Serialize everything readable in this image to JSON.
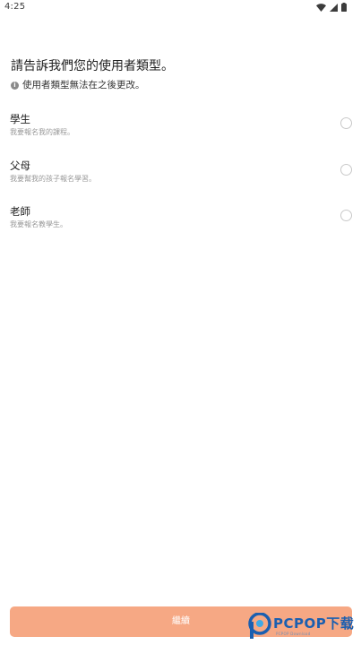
{
  "status_bar": {
    "time": "4:25",
    "icons": [
      "wifi-icon",
      "signal-icon",
      "battery-icon"
    ]
  },
  "header": {
    "title": "請告訴我們您的使用者類型。",
    "note": "使用者類型無法在之後更改。",
    "note_icon": "info-icon"
  },
  "options": [
    {
      "title": "學生",
      "description": "我要報名我的課程。",
      "selected": false
    },
    {
      "title": "父母",
      "description": "我要幫我的孩子報名學習。",
      "selected": false
    },
    {
      "title": "老師",
      "description": "我要報名教學生。",
      "selected": false
    }
  ],
  "continue_button": {
    "label": "繼續",
    "enabled": false,
    "color": "#f6a884"
  },
  "watermark": {
    "brand": "PCPOP下载",
    "sub": "PCPOP Download",
    "color": "#1b5fb0"
  }
}
